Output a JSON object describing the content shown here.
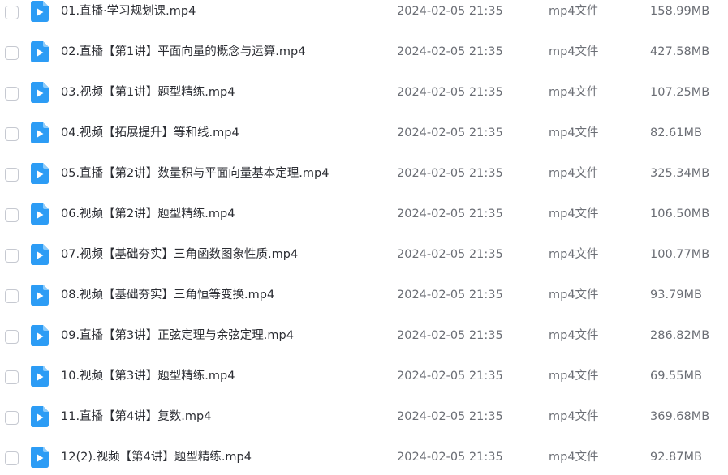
{
  "icons": {
    "file": "video-file-icon",
    "accent": "#2c9cf5"
  },
  "files": [
    {
      "name": "01.直播·学习规划课.mp4",
      "date": "2024-02-05 21:35",
      "type": "mp4文件",
      "size": "158.99MB"
    },
    {
      "name": "02.直播【第1讲】平面向量的概念与运算.mp4",
      "date": "2024-02-05 21:35",
      "type": "mp4文件",
      "size": "427.58MB"
    },
    {
      "name": "03.视频【第1讲】题型精练.mp4",
      "date": "2024-02-05 21:35",
      "type": "mp4文件",
      "size": "107.25MB"
    },
    {
      "name": "04.视频【拓展提升】等和线.mp4",
      "date": "2024-02-05 21:35",
      "type": "mp4文件",
      "size": "82.61MB"
    },
    {
      "name": "05.直播【第2讲】数量积与平面向量基本定理.mp4",
      "date": "2024-02-05 21:35",
      "type": "mp4文件",
      "size": "325.34MB"
    },
    {
      "name": "06.视频【第2讲】题型精练.mp4",
      "date": "2024-02-05 21:35",
      "type": "mp4文件",
      "size": "106.50MB"
    },
    {
      "name": "07.视频【基础夯实】三角函数图象性质.mp4",
      "date": "2024-02-05 21:35",
      "type": "mp4文件",
      "size": "100.77MB"
    },
    {
      "name": "08.视频【基础夯实】三角恒等变换.mp4",
      "date": "2024-02-05 21:35",
      "type": "mp4文件",
      "size": "93.79MB"
    },
    {
      "name": "09.直播【第3讲】正弦定理与余弦定理.mp4",
      "date": "2024-02-05 21:35",
      "type": "mp4文件",
      "size": "286.82MB"
    },
    {
      "name": "10.视频【第3讲】题型精练.mp4",
      "date": "2024-02-05 21:35",
      "type": "mp4文件",
      "size": "69.55MB"
    },
    {
      "name": "11.直播【第4讲】复数.mp4",
      "date": "2024-02-05 21:35",
      "type": "mp4文件",
      "size": "369.68MB"
    },
    {
      "name": "12(2).视频【第4讲】题型精练.mp4",
      "date": "2024-02-05 21:35",
      "type": "mp4文件",
      "size": "92.87MB"
    }
  ]
}
